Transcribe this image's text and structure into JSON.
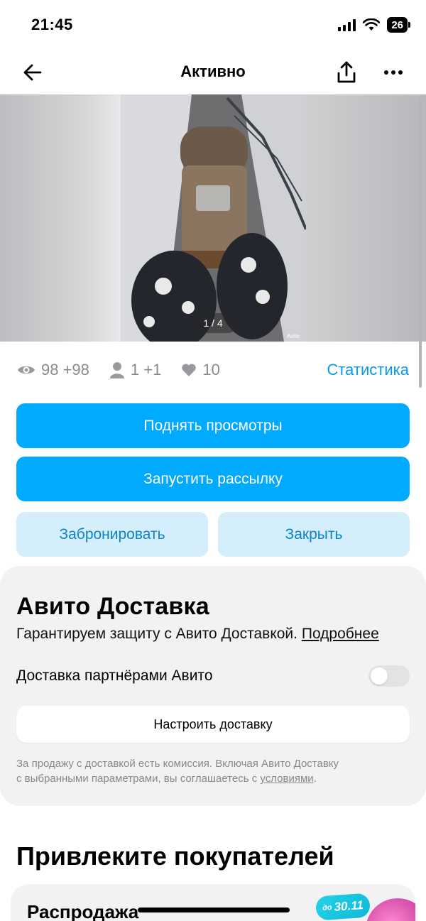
{
  "status_bar": {
    "time": "21:45",
    "battery": "26"
  },
  "nav": {
    "title": "Активно"
  },
  "gallery": {
    "counter": "1 / 4",
    "watermark": "Avito"
  },
  "stats": {
    "views": "98 +98",
    "contacts": "1 +1",
    "favorites": "10",
    "link": "Статистика"
  },
  "actions": {
    "raise_views": "Поднять просмотры",
    "start_mailing": "Запустить рассылку",
    "reserve": "Забронировать",
    "close": "Закрыть"
  },
  "delivery": {
    "title": "Авито Доставка",
    "subtitle": "Гарантируем защиту с Авито Доставкой.",
    "more_link": "Подробнее",
    "partners_label": "Доставка партнёрами Авито",
    "partners_enabled": false,
    "setup_button": "Настроить доставку",
    "note_line1": "За продажу с доставкой есть комиссия. Включая Авито Доставку",
    "note_line2_prefix": "с выбранными параметрами, вы соглашаетесь с",
    "note_link": "условиями",
    "note_suffix": "."
  },
  "promo": {
    "title": "Привлеките покупателей",
    "card_title": "Распродажа",
    "badge_prefix": "до",
    "badge_date": "30.11"
  },
  "colors": {
    "accent": "#00aaff",
    "link": "#0a9ae8",
    "secondary_bg": "#d5eefc",
    "card_bg": "#f2f2f3"
  }
}
